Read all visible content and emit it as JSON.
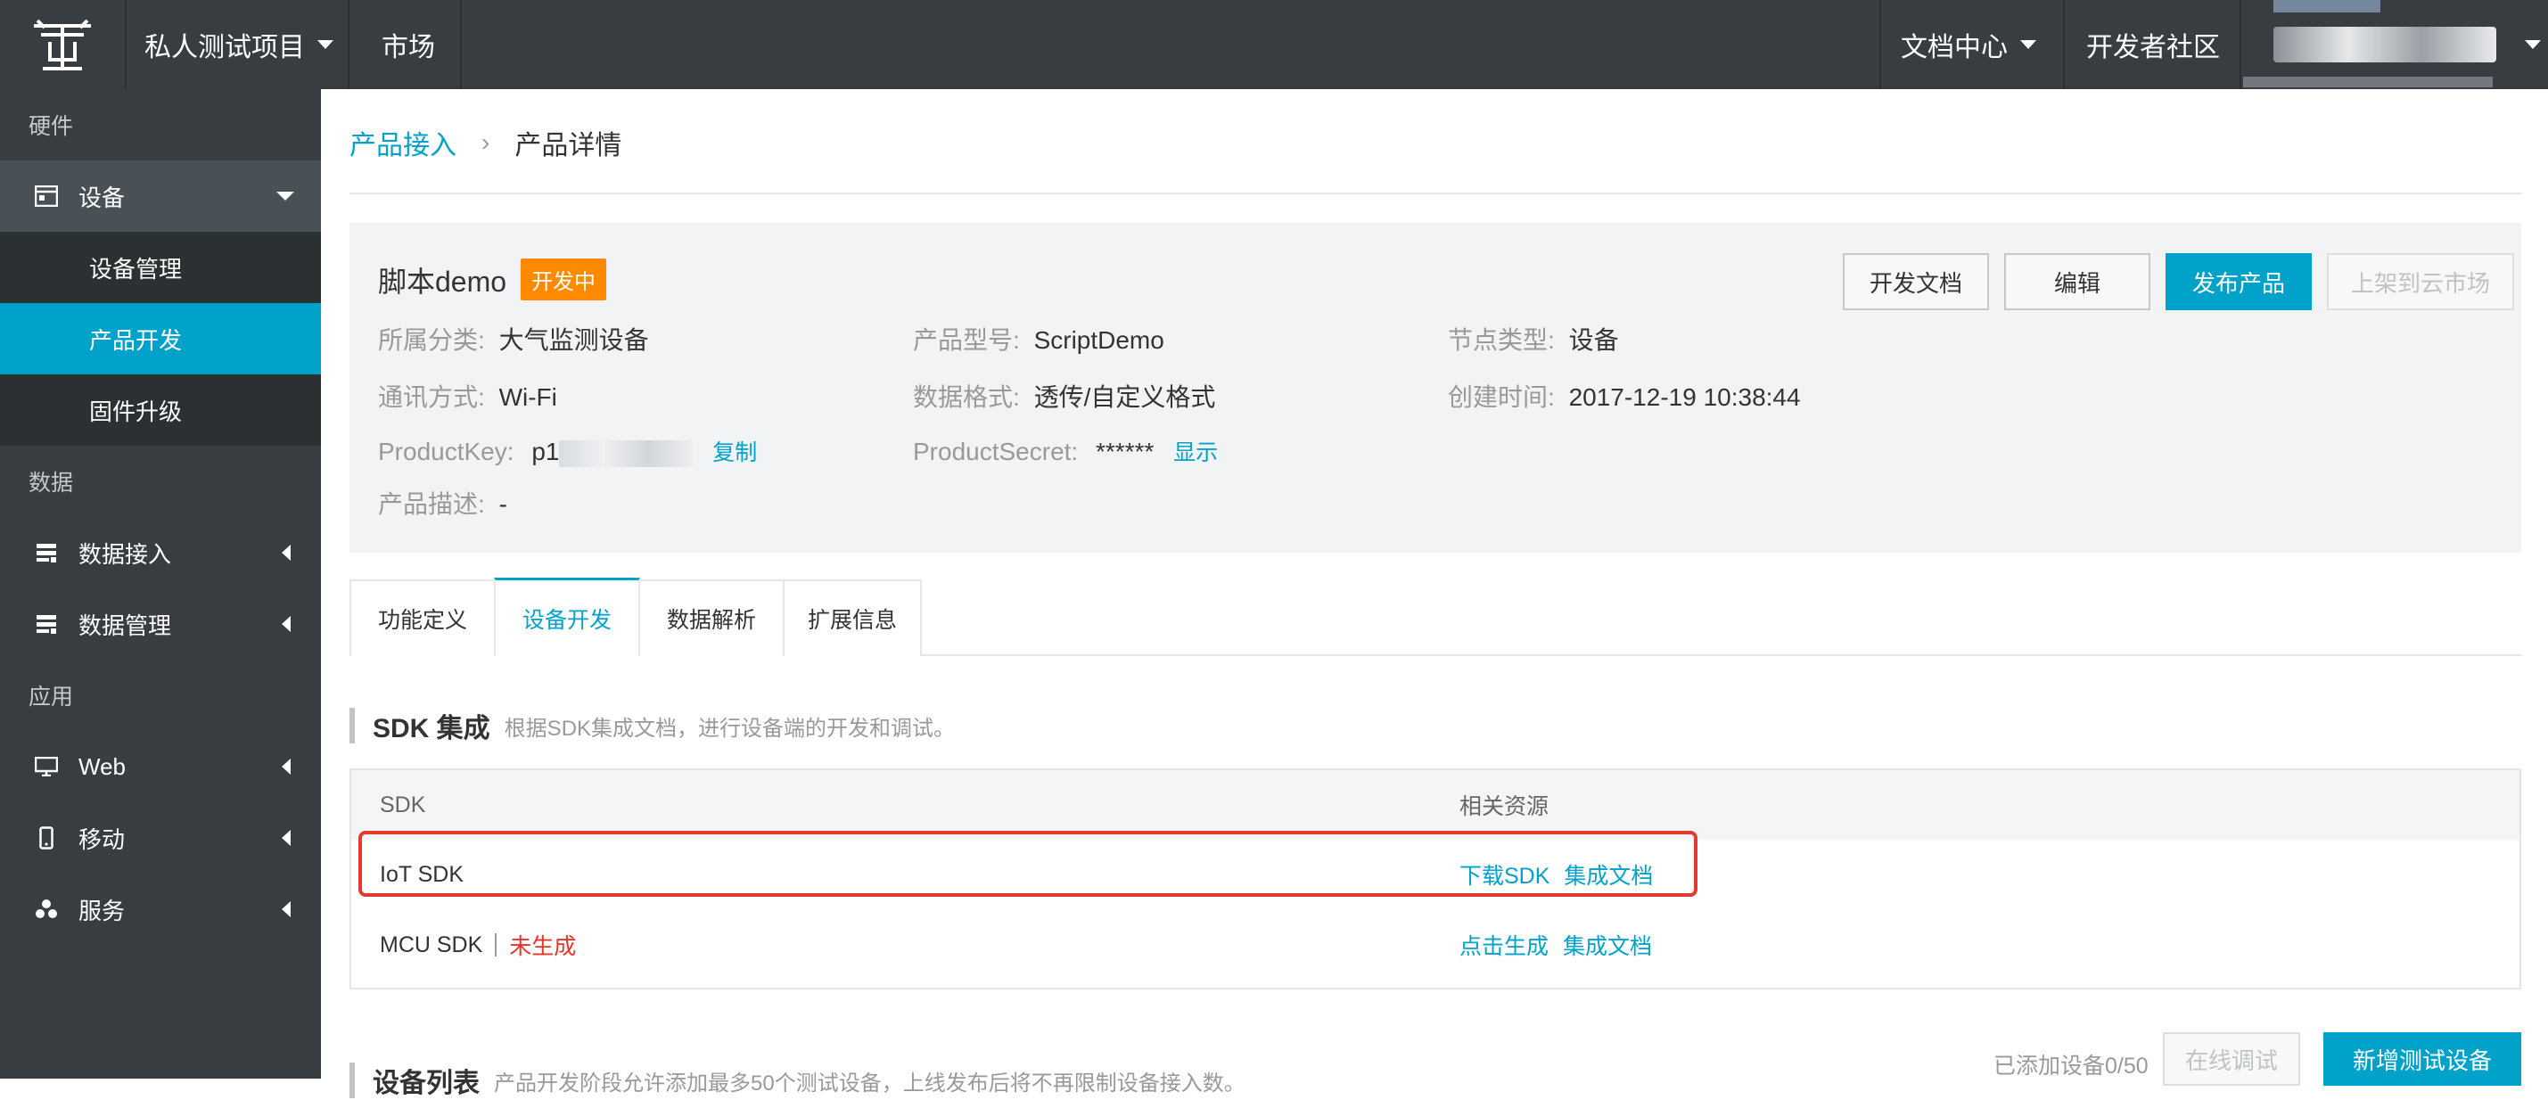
{
  "topbar": {
    "project_label": "私人测试项目",
    "market_label": "市场",
    "docs_label": "文档中心",
    "community_label": "开发者社区"
  },
  "sidebar": {
    "group_hardware": "硬件",
    "device": "设备",
    "device_mgmt": "设备管理",
    "product_dev": "产品开发",
    "firmware": "固件升级",
    "group_data": "数据",
    "data_access": "数据接入",
    "data_mgmt": "数据管理",
    "group_app": "应用",
    "web": "Web",
    "mobile": "移动",
    "service": "服务"
  },
  "breadcrumb": {
    "parent": "产品接入",
    "separator": "›",
    "current": "产品详情"
  },
  "product": {
    "name": "脚本demo",
    "status": "开发中",
    "category_key": "所属分类:",
    "category_val": "大气监测设备",
    "model_key": "产品型号:",
    "model_val": "ScriptDemo",
    "node_key": "节点类型:",
    "node_val": "设备",
    "comm_key": "通讯方式:",
    "comm_val": "Wi-Fi",
    "format_key": "数据格式:",
    "format_val": "透传/自定义格式",
    "created_key": "创建时间:",
    "created_val": "2017-12-19 10:38:44",
    "pk_key": "ProductKey:",
    "pk_val": "p1",
    "copy_label": "复制",
    "ps_key": "ProductSecret:",
    "ps_val": "******",
    "show_label": "显示",
    "desc_key": "产品描述:",
    "desc_val": "-"
  },
  "buttons": {
    "dev_docs": "开发文档",
    "edit": "编辑",
    "publish": "发布产品",
    "list_market": "上架到云市场"
  },
  "tabs": [
    "功能定义",
    "设备开发",
    "数据解析",
    "扩展信息"
  ],
  "sdk_section": {
    "title": "SDK 集成",
    "desc": "根据SDK集成文档，进行设备端的开发和调试。",
    "col_sdk": "SDK",
    "col_res": "相关资源",
    "rows": [
      {
        "name": "IoT SDK",
        "status": "",
        "res1": "下载SDK",
        "res2": "集成文档"
      },
      {
        "name": "MCU SDK",
        "status": "未生成",
        "res1": "点击生成",
        "res2": "集成文档"
      }
    ]
  },
  "device_section": {
    "title": "设备列表",
    "desc": "产品开发阶段允许添加最多50个测试设备，上线发布后将不再限制设备接入数。",
    "count": "已添加设备0/50",
    "online_debug": "在线调试",
    "add_test_device": "新增测试设备"
  },
  "colors": {
    "accent": "#00a2ca",
    "nav_bg": "#373d41",
    "badge": "#ff8a00",
    "highlight": "#e23a2f"
  }
}
